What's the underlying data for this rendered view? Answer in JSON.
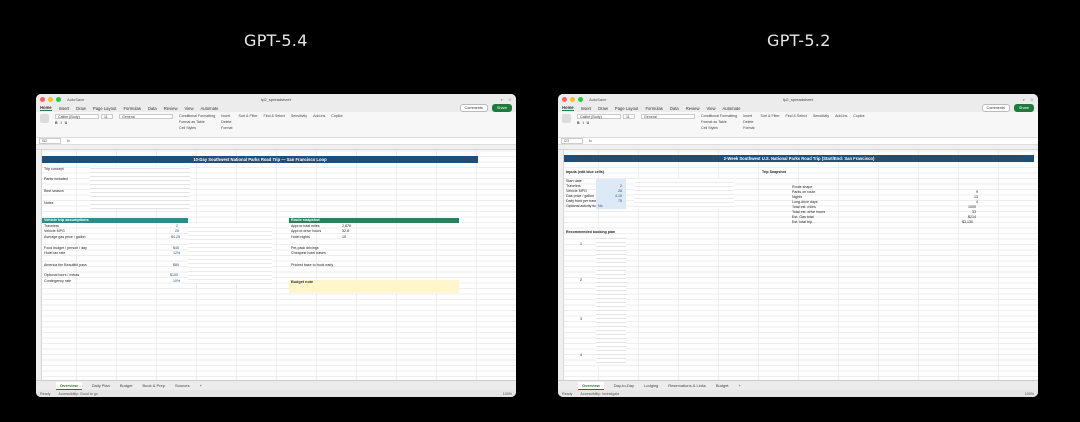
{
  "headings": {
    "left": "GPT-5.4",
    "right": "GPT-5.2"
  },
  "colors": {
    "header_blue": "#1f4e79",
    "band_teal": "#2e8b8b",
    "band_green": "#2e7d5b",
    "excel_green": "#1f7a3d",
    "note_yellow": "#fff6cc"
  },
  "left": {
    "window_title": "tp2_spreadsheet",
    "autosave": "AutoSave",
    "menu": [
      "Home",
      "Insert",
      "Draw",
      "Page Layout",
      "Formulas",
      "Data",
      "Review",
      "View",
      "Automate"
    ],
    "comments": "Comments",
    "share": "Share",
    "font": "Calibri (Body)",
    "font_size": "11",
    "number_format": "General",
    "ribbon_right": [
      "Conditional Formatting",
      "Format as Table",
      "Cell Styles",
      "Insert",
      "Delete",
      "Format",
      "Sort & Filter",
      "Find & Select",
      "Sensitivity",
      "Add-ins",
      "Copilot"
    ],
    "name_box": "I52",
    "banner": "10-Day Southwest National Parks Road Trip — San Francisco Loop",
    "info_rows": [
      "Trip concept",
      "Parks included",
      "Best season",
      "Notes"
    ],
    "band_a": "Vehicle trip assumptions",
    "band_b": "Route snapshot",
    "assumptions": [
      "Travelers",
      "Vehicle MPG",
      "Average gas price / gallon",
      "Food budget / person / day",
      "Hotel tax rate",
      "America the Beautiful pass",
      "Optional tours / extras",
      "Contingency rate"
    ],
    "snapshot": [
      "Approx total miles",
      "Approx drive hours",
      "Hotel nights",
      "Pet-pack drivings",
      "Cheapest hotel bases",
      "Priciest base to book early"
    ],
    "values": [
      "2",
      "25",
      "$4.25",
      "$45",
      "12%",
      "$80",
      "$150",
      "10%"
    ],
    "snapshot_values": [
      "2,878",
      "52.8",
      "10"
    ],
    "budget_note_title": "Budget note",
    "tabs": [
      "Overview",
      "Daily Plan",
      "Budget",
      "Book & Prep",
      "Sources"
    ],
    "status": "Ready",
    "accessibility": "Accessibility: Good to go",
    "zoom": "100%"
  },
  "right": {
    "window_title": "tp2_spreadsheet",
    "autosave": "AutoSave",
    "menu": [
      "Home",
      "Insert",
      "Draw",
      "Page Layout",
      "Formulas",
      "Data",
      "Review",
      "View",
      "Automate"
    ],
    "comments": "Comments",
    "share": "Share",
    "font": "Calibri (Body)",
    "font_size": "11",
    "number_format": "General",
    "ribbon_right": [
      "Conditional Formatting",
      "Format as Table",
      "Cell Styles",
      "Insert",
      "Delete",
      "Format",
      "Sort & Filter",
      "Find & Select",
      "Sensitivity",
      "Add-ins",
      "Copilot"
    ],
    "name_box": "I23",
    "banner": "2-Week Southwest U.S. National Parks Road Trip (Start/End: San Francisco)",
    "band_a": "Inputs (edit blue cells)",
    "band_b": "Trip Snapshot",
    "inputs": [
      "Start date",
      "Travelers",
      "Vehicle MPG",
      "Gas price / gallon",
      "Daily food per traveler",
      "Optional activity tickets"
    ],
    "input_values": [
      "",
      "2",
      "28",
      "4.15",
      "75",
      "No"
    ],
    "snapshot": [
      "Route shape",
      "Parks on route",
      "Nights",
      "Long-drive days",
      "Total est. miles",
      "Total est. drive hours",
      "Est. Gas total",
      "Est. total trip"
    ],
    "snapshot_values": [
      "",
      "9",
      "13",
      "4",
      "1000",
      "33",
      "$214",
      "$3,130"
    ],
    "band_c": "Recommended booking plan",
    "booking_nums": [
      "1",
      "2",
      "3",
      "4"
    ],
    "tabs": [
      "Overview",
      "Day-to-Day",
      "Lodging",
      "Reservations & Links",
      "Budget"
    ],
    "status": "Ready",
    "accessibility": "Accessibility: Investigate",
    "zoom": "100%"
  }
}
